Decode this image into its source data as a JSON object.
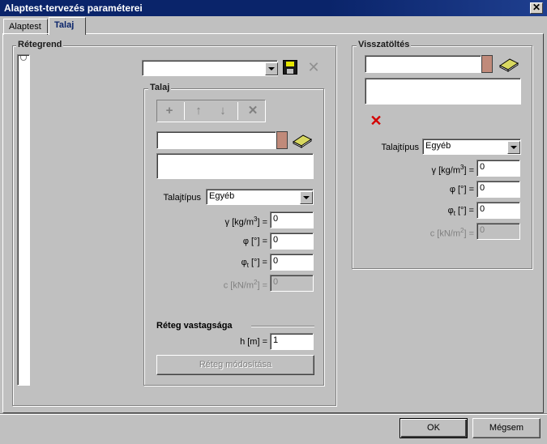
{
  "window": {
    "title": "Alaptest-tervezés paraméterei",
    "close_glyph": "✕"
  },
  "tabs": [
    {
      "label": "Alaptest",
      "active": false
    },
    {
      "label": "Talaj",
      "active": true
    }
  ],
  "retegrend": {
    "label": "Rétegrend",
    "combo_value": ""
  },
  "talaj": {
    "label": "Talaj",
    "toolbar": {
      "add": "+",
      "up": "↑",
      "down": "↓",
      "delete": "✕"
    },
    "name_value": "",
    "desc_value": "",
    "talajtipus_label": "Talajtípus",
    "talajtipus_value": "Egyéb",
    "gamma_label": "γ [kg/m",
    "gamma_sup": "3",
    "gamma_suffix": "] =",
    "gamma_value": "0",
    "phi_label": "φ [°] =",
    "phi_value": "0",
    "phit_label": "φ",
    "phit_sub": "t",
    "phit_suffix": " [°] =",
    "phit_value": "0",
    "c_label": "c [kN/m",
    "c_sup": "2",
    "c_suffix": "] =",
    "c_value": "0",
    "reteg_vastagsag_label": "Réteg vastagsága",
    "h_label": "h [m] =",
    "h_value": "1",
    "modify_button": "Réteg módosítása"
  },
  "visszatoltes": {
    "label": "Visszatöltés",
    "name_value": "",
    "desc_value": "",
    "talajtipus_label": "Talajtípus",
    "talajtipus_value": "Egyéb",
    "gamma_label": "γ [kg/m",
    "gamma_sup": "3",
    "gamma_suffix": "] =",
    "gamma_value": "0",
    "phi_label": "φ [°] =",
    "phi_value": "0",
    "phit_label": "φ",
    "phit_sub": "t",
    "phit_suffix": " [°] =",
    "phit_value": "0",
    "c_label": "c [kN/m",
    "c_sup": "2",
    "c_suffix": "] =",
    "c_value": "0"
  },
  "footer": {
    "ok_label": "OK",
    "cancel_label": "Mégsem"
  },
  "colors": {
    "title_bar": "#0a246a",
    "swatch": "#c08a7a",
    "delete_red": "#d40000"
  }
}
